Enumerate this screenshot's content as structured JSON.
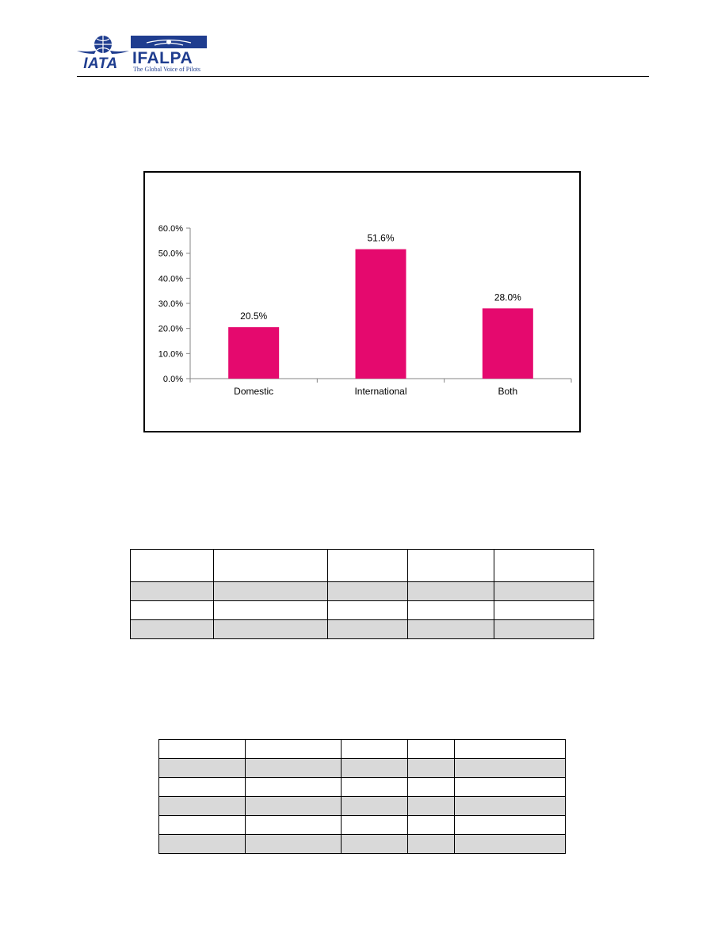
{
  "header": {
    "iata_logo_text": "IATA",
    "ifalpa_logo_text": "IFALPA",
    "ifalpa_tagline": "The Global Voice of Pilots",
    "brand_color": "#1f3d8f"
  },
  "chart_data": {
    "type": "bar",
    "categories": [
      "Domestic",
      "International",
      "Both"
    ],
    "values": [
      20.5,
      51.6,
      28.0
    ],
    "data_labels": [
      "20.5%",
      "51.6%",
      "28.0%"
    ],
    "yticks": [
      "0.0%",
      "10.0%",
      "20.0%",
      "30.0%",
      "40.0%",
      "50.0%",
      "60.0%"
    ],
    "ylim": [
      0,
      60
    ],
    "title": "",
    "xlabel": "",
    "ylabel": "",
    "grid": false,
    "bar_color": "#e5096e"
  },
  "table1": {
    "columns": 5,
    "rows": [
      {
        "type": "header",
        "shaded": false
      },
      {
        "type": "row",
        "shaded": true
      },
      {
        "type": "row",
        "shaded": false
      },
      {
        "type": "row",
        "shaded": true
      }
    ]
  },
  "table2": {
    "columns": 5,
    "rows": [
      {
        "shaded": false
      },
      {
        "shaded": true
      },
      {
        "shaded": false
      },
      {
        "shaded": true
      },
      {
        "shaded": false
      },
      {
        "shaded": true
      }
    ]
  }
}
